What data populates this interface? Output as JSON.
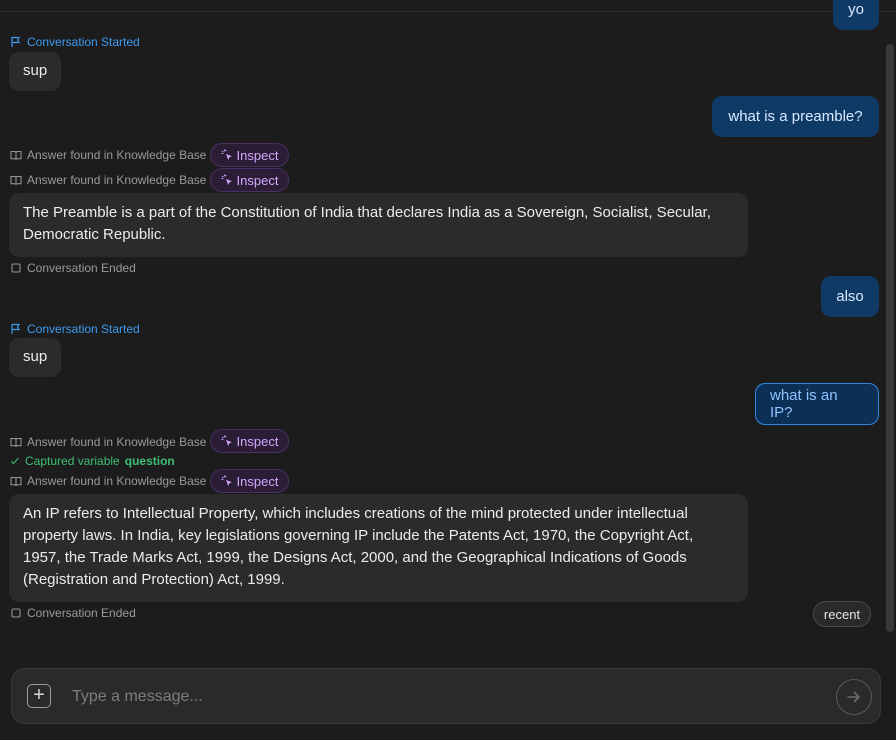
{
  "chat": {
    "partial_user_message": "yo",
    "events": {
      "conversation_started": "Conversation Started",
      "conversation_ended": "Conversation Ended",
      "knowledge_base": "Answer found in Knowledge Base",
      "inspect": "Inspect",
      "captured_prefix": "Captured variable",
      "captured_variable": "question"
    },
    "messages": {
      "bot_sup_1": "sup",
      "user_q1": "what is a preamble?",
      "bot_answer_1": "The Preamble is a part of the Constitution of India that declares India as a Sovereign, Socialist, Secular, Democratic Republic.",
      "user_also": "also",
      "bot_sup_2": "sup",
      "user_q2": "what is an IP?",
      "bot_answer_2": "An IP refers to Intellectual Property, which includes creations of the mind protected under intellectual property laws. In India, key legislations governing IP include the Patents Act, 1970, the Copyright Act, 1957, the Trade Marks Act, 1999, the Designs Act, 2000, and the Geographical Indications of Goods (Registration and Protection) Act, 1999."
    }
  },
  "recent_label": "recent",
  "composer": {
    "placeholder": "Type a message...",
    "value": ""
  },
  "icons": {
    "flag": "flag-icon",
    "book": "book-icon",
    "square": "square-icon",
    "check": "check-icon",
    "cursor": "cursor-click-icon",
    "plus": "plus-icon",
    "send": "arrow-right-icon"
  },
  "colors": {
    "background": "#1c1c1c",
    "bot_bubble": "#2b2b2b",
    "user_bubble": "#0f3a66",
    "accent_blue": "#3d9bf0",
    "inspect_purple": "#d6a8ff",
    "success_green": "#3fbf74"
  }
}
